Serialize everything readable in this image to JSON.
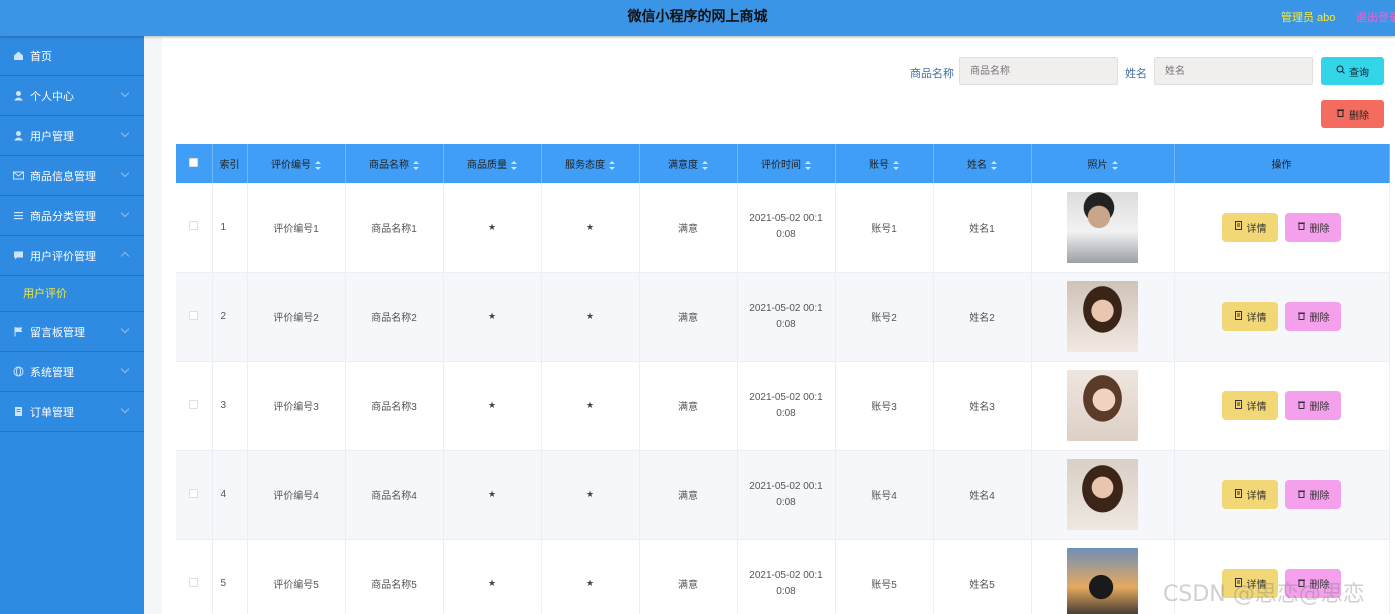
{
  "header": {
    "title": "微信小程序的网上商城",
    "admin": "管理员 abo",
    "logout": "退出登录"
  },
  "sidebar": {
    "items": [
      {
        "label": "首页",
        "icon": "home-icon",
        "expandable": false
      },
      {
        "label": "个人中心",
        "icon": "user-icon",
        "expandable": true
      },
      {
        "label": "用户管理",
        "icon": "user-icon",
        "expandable": true
      },
      {
        "label": "商品信息管理",
        "icon": "mail-icon",
        "expandable": true
      },
      {
        "label": "商品分类管理",
        "icon": "list-icon",
        "expandable": true
      },
      {
        "label": "用户评价管理",
        "icon": "chat-icon",
        "expandable": true,
        "expanded": true
      },
      {
        "label": "留言板管理",
        "icon": "flag-icon",
        "expandable": true
      },
      {
        "label": "系统管理",
        "icon": "globe-icon",
        "expandable": true
      },
      {
        "label": "订单管理",
        "icon": "doc-icon",
        "expandable": true
      }
    ],
    "sub_active": "用户评价"
  },
  "search": {
    "product_label": "商品名称",
    "product_placeholder": "商品名称",
    "name_label": "姓名",
    "name_placeholder": "姓名",
    "query_button": "查询",
    "delete_button": "删除"
  },
  "table": {
    "columns": [
      "索引",
      "评价编号",
      "商品名称",
      "商品质量",
      "服务态度",
      "满意度",
      "评价时间",
      "账号",
      "姓名",
      "照片",
      "操作"
    ],
    "detail_label": "详情",
    "delete_label": "删除",
    "rows": [
      {
        "index": "1",
        "code": "评价编号1",
        "product": "商品名称1",
        "quality": "★",
        "service": "★",
        "satisfaction": "满意",
        "time": "2021-05-02 00:10:08",
        "account": "账号1",
        "name": "姓名1"
      },
      {
        "index": "2",
        "code": "评价编号2",
        "product": "商品名称2",
        "quality": "★",
        "service": "★",
        "satisfaction": "满意",
        "time": "2021-05-02 00:10:08",
        "account": "账号2",
        "name": "姓名2"
      },
      {
        "index": "3",
        "code": "评价编号3",
        "product": "商品名称3",
        "quality": "★",
        "service": "★",
        "satisfaction": "满意",
        "time": "2021-05-02 00:10:08",
        "account": "账号3",
        "name": "姓名3"
      },
      {
        "index": "4",
        "code": "评价编号4",
        "product": "商品名称4",
        "quality": "★",
        "service": "★",
        "satisfaction": "满意",
        "time": "2021-05-02 00:10:08",
        "account": "账号4",
        "name": "姓名4"
      },
      {
        "index": "5",
        "code": "评价编号5",
        "product": "商品名称5",
        "quality": "★",
        "service": "★",
        "satisfaction": "满意",
        "time": "2021-05-02 00:10:08",
        "account": "账号5",
        "name": "姓名5"
      }
    ]
  },
  "watermark": "CSDN @思恋@思恋",
  "colors": {
    "topbar": "#3a95e6",
    "sidebar": "#2f8ae2",
    "table_header": "#409ef7",
    "query_button": "#33d6e8",
    "delete_button": "#f36c5f",
    "detail_button": "#f2d777",
    "row_delete_button": "#f5a0ec"
  }
}
